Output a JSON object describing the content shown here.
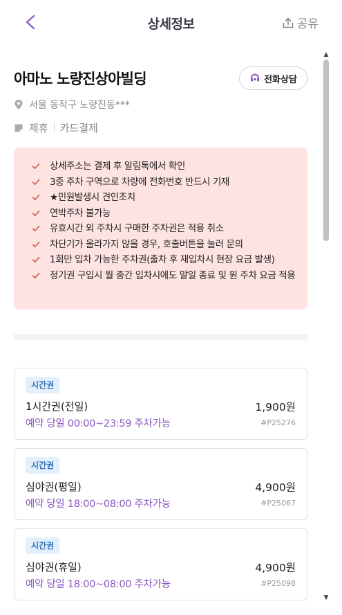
{
  "header": {
    "title": "상세정보",
    "share_label": "공유"
  },
  "place": {
    "name": "아마노 노량진상아빌딩",
    "call_label": "전화상담",
    "address": "서울 동작구 노량진동***",
    "tags": [
      "제휴",
      "카드결제"
    ]
  },
  "notices": [
    "상세주소는 결제 후 알림톡에서 확인",
    "3중 주차 구역으로 차량에 전화번호 반드시 기재",
    "★민원발생시 견인조치",
    "연박주차 불가능",
    "유효시간 외 주차시 구매한 주차권은 적용 취소",
    "차단기가 올라가지 않을 경우, 호출버튼을 눌러 문의",
    "1회만 입차 가능한 주차권(출차 후 재입차시 현장 요금 발생)",
    "정기권 구입시 월 중간 입차시에도 말일 종료 및 원 주차 요금 적용"
  ],
  "tickets": [
    {
      "badge": "시간권",
      "name": "1시간권(전일)",
      "price": "1,900원",
      "time": "예약 당일 00:00~23:59 주차가능",
      "code": "#P25276"
    },
    {
      "badge": "시간권",
      "name": "심야권(평일)",
      "price": "4,900원",
      "time": "예약 당일 18:00~08:00 주차가능",
      "code": "#P25067"
    },
    {
      "badge": "시간권",
      "name": "심야권(휴일)",
      "price": "4,900원",
      "time": "예약 당일 18:00~08:00 주차가능",
      "code": "#P25098"
    }
  ],
  "colors": {
    "accent": "#8a58c0",
    "notice_bg": "#fde3e1",
    "check": "#d9534f",
    "badge_bg": "#e3effb",
    "badge_text": "#2f6fba"
  }
}
